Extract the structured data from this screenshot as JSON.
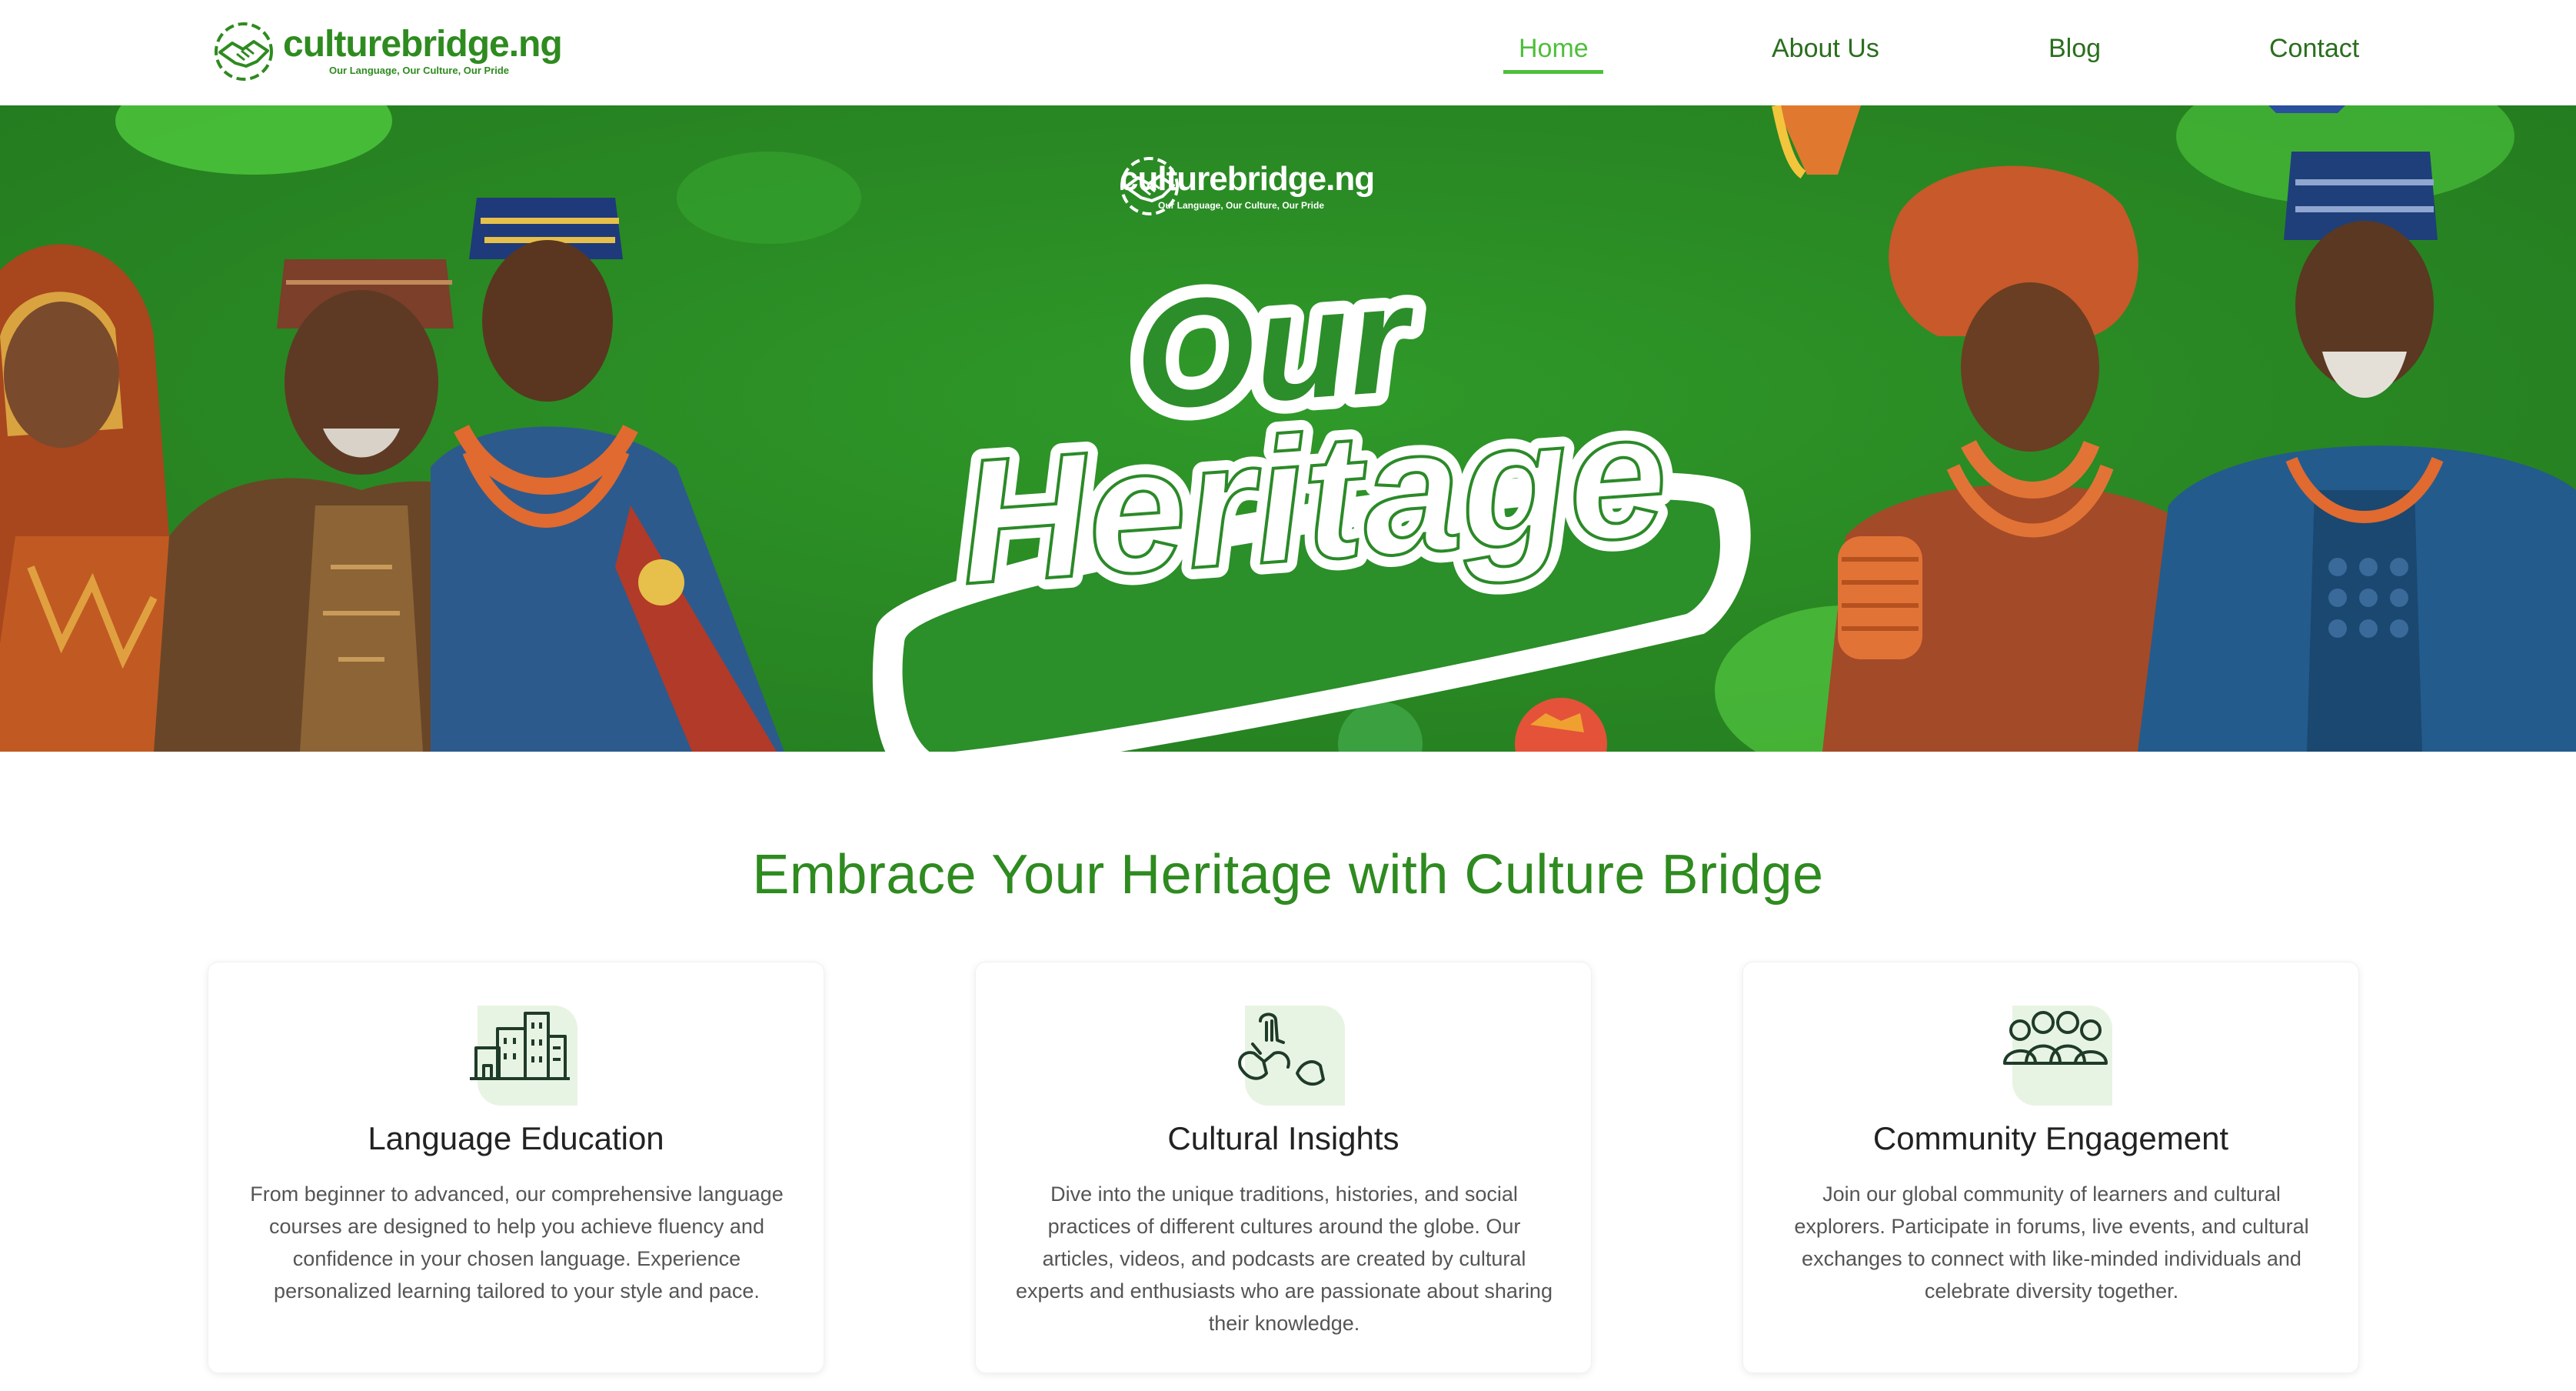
{
  "brand": {
    "name": "culturebridge.ng",
    "tagline": "Our Language, Our Culture, Our Pride",
    "color": "#2e8b1f",
    "accent": "#4fbf3a"
  },
  "nav": {
    "items": [
      {
        "label": "Home",
        "active": true
      },
      {
        "label": "About Us",
        "active": false
      },
      {
        "label": "Blog",
        "active": false
      },
      {
        "label": "Contact",
        "active": false
      }
    ]
  },
  "hero": {
    "logo_name": "culturebridge.ng",
    "logo_tagline": "Our Language, Our Culture, Our Pride",
    "title_line1": "Our",
    "title_line2": "Heritage"
  },
  "main": {
    "heading": "Embrace Your Heritage with Culture Bridge",
    "cards": [
      {
        "icon": "buildings-icon",
        "title": "Language Education",
        "text": "From beginner to advanced, our comprehensive language courses are designed to help you achieve fluency and confidence in your chosen language. Experience personalized learning tailored to your style and pace."
      },
      {
        "icon": "hands-icon",
        "title": "Cultural Insights",
        "text": "Dive into the unique traditions, histories, and social practices of different cultures around the globe. Our articles, videos, and podcasts are created by cultural experts and enthusiasts who are passionate about sharing their knowledge."
      },
      {
        "icon": "community-icon",
        "title": "Community Engagement",
        "text": "Join our global community of learners and cultural explorers. Participate in forums, live events, and cultural exchanges to connect with like-minded individuals and celebrate diversity together."
      }
    ]
  }
}
